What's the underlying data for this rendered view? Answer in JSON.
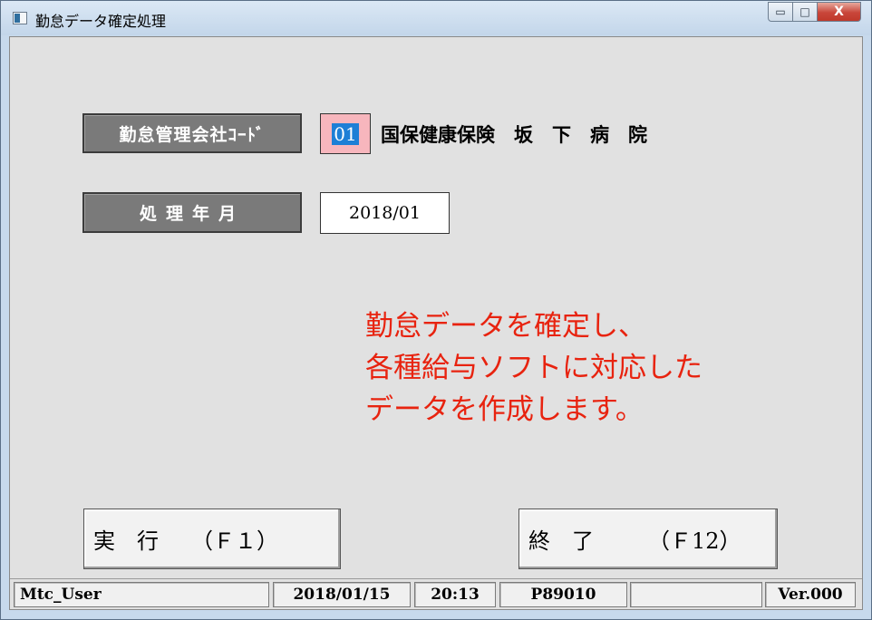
{
  "window": {
    "title": "勤怠データ確定処理",
    "controls": {
      "minimize": "▭",
      "maximize": "□",
      "close": "X"
    }
  },
  "form": {
    "company_label": "勤怠管理会社ｺｰﾄﾞ",
    "company_code": "01",
    "company_name": "国保健康保険　坂　下　病　院",
    "period_label": "処理年月",
    "period_value": "2018/01"
  },
  "message": "勤怠データを確定し、\n各種給与ソフトに対応した\nデータを作成します。",
  "buttons": {
    "execute": "実　行　　（Ｆ１）",
    "exit": "終　了　　　（Ｆ12）"
  },
  "status_bar": {
    "user": "Mtc_User",
    "date": "2018/01/15",
    "time": "20:13",
    "program": "P89010",
    "blank": "",
    "version": "Ver.000"
  },
  "colors": {
    "accent_red": "#e8230f",
    "code_highlight": "#f7b6bd",
    "selection_blue": "#1e7fd6",
    "label_gray": "#7a7a7a"
  }
}
